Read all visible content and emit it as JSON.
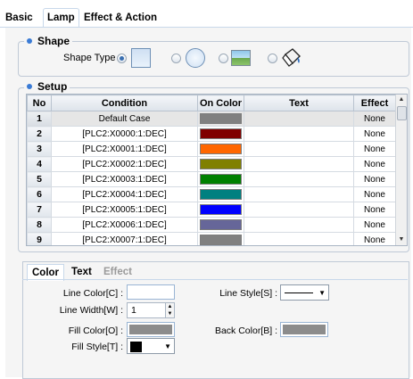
{
  "main_tabs": [
    "Basic",
    "Lamp",
    "Effect & Action"
  ],
  "shape_section": {
    "title": "Shape",
    "shape_type_label": "Shape Type :",
    "options": [
      {
        "name": "square",
        "checked": true
      },
      {
        "name": "circle",
        "checked": false
      },
      {
        "name": "picture",
        "checked": false
      },
      {
        "name": "paint-bucket",
        "checked": false
      }
    ]
  },
  "setup_section": {
    "title": "Setup",
    "columns": [
      "No",
      "Condition",
      "On Color",
      "Text",
      "Effect"
    ],
    "rows": [
      {
        "no": "1",
        "condition": "Default Case",
        "color": "#808080",
        "text": "",
        "effect": "None"
      },
      {
        "no": "2",
        "condition": "[PLC2:X0000:1:DEC]",
        "color": "#800000",
        "text": "",
        "effect": "None"
      },
      {
        "no": "3",
        "condition": "[PLC2:X0001:1:DEC]",
        "color": "#ff6600",
        "text": "",
        "effect": "None"
      },
      {
        "no": "4",
        "condition": "[PLC2:X0002:1:DEC]",
        "color": "#808000",
        "text": "",
        "effect": "None"
      },
      {
        "no": "5",
        "condition": "[PLC2:X0003:1:DEC]",
        "color": "#008000",
        "text": "",
        "effect": "None"
      },
      {
        "no": "6",
        "condition": "[PLC2:X0004:1:DEC]",
        "color": "#008080",
        "text": "",
        "effect": "None"
      },
      {
        "no": "7",
        "condition": "[PLC2:X0005:1:DEC]",
        "color": "#0000ff",
        "text": "",
        "effect": "None"
      },
      {
        "no": "8",
        "condition": "[PLC2:X0006:1:DEC]",
        "color": "#666699",
        "text": "",
        "effect": "None"
      },
      {
        "no": "9",
        "condition": "[PLC2:X0007:1:DEC]",
        "color": "#808080",
        "text": "",
        "effect": "None"
      }
    ]
  },
  "property_tabs": [
    "Color",
    "Text",
    "Effect"
  ],
  "color_props": {
    "line_color_label": "Line Color[C] :",
    "line_width_label": "Line Width[W] :",
    "line_width_value": "1",
    "fill_color_label": "Fill Color[O] :",
    "fill_style_label": "Fill Style[T] :",
    "line_style_label": "Line Style[S] :",
    "back_color_label": "Back Color[B] :",
    "fill_color": "#8c8c8c",
    "back_color": "#8c8c8c",
    "accent": "#3a7bd5"
  }
}
